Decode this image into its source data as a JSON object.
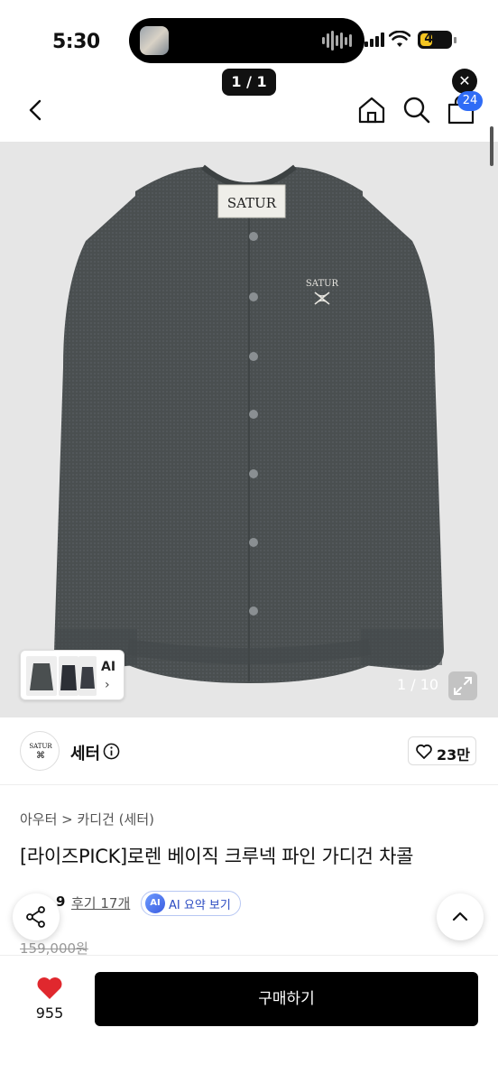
{
  "status_bar": {
    "time": "5:30",
    "battery": "41",
    "battery_level": 0.41
  },
  "pager": "1 / 1",
  "close_glyph": "✕",
  "nav": {
    "back_icon": "chevron-left-icon",
    "home_icon": "home-icon",
    "search_icon": "search-icon",
    "bag_icon": "shopping-bag-icon",
    "cart_count": "24"
  },
  "gallery": {
    "brand_tag": "SATUR",
    "chest_logo": "SATUR",
    "ai_label": "AI",
    "ai_chevron": "›",
    "counter": "1 / 10",
    "sweater_color": "#4a4f50"
  },
  "brand": {
    "logo_text": "SATUR",
    "logo_mark": "⌘",
    "name": "세터",
    "like_count": "23만"
  },
  "breadcrumb": "아우터 > 카디건 (세터)",
  "product": {
    "title": "[라이즈PICK]로렌 베이직 크루넥 파인 가디건 차콜",
    "rating_partial": "9",
    "reviews": "후기 17개",
    "ai_icon_label": "AI",
    "ai_summary": "AI 요약 보기",
    "original_price": "159,000원"
  },
  "bottom_bar": {
    "likes": "955",
    "buy_label": "구매하기"
  },
  "colors": {
    "accent_blue": "#2f6cf6",
    "heart_red": "#e0282e",
    "buy_button": "#000000"
  }
}
